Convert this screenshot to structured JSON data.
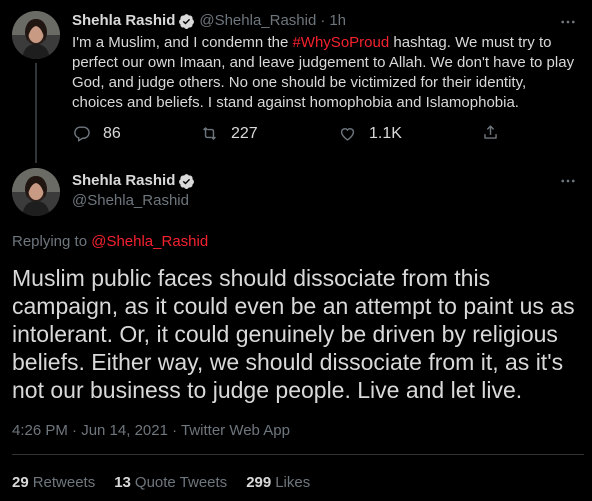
{
  "colors": {
    "background": "#000000",
    "text": "#d9d9d9",
    "secondary": "#6e767d",
    "accent_link": "#f4212e",
    "divider": "#2f3336"
  },
  "tweet1": {
    "avatar_icon": "profile-photo",
    "name": "Shehla Rashid",
    "verified_icon": "verified-badge-icon",
    "handle": "@Shehla_Rashid",
    "separator": "·",
    "time": "1h",
    "text_before": "I'm a Muslim, and I condemn the ",
    "hashtag": "#WhySoProud",
    "text_after": " hashtag. We must try to perfect our own Imaan, and leave judgement to Allah. We don't have to play God, and judge others. No one should be victimized for their identity, choices and beliefs. I stand against homophobia and Islamophobia.",
    "replies": "86",
    "retweets": "227",
    "likes": "1.1K"
  },
  "tweet2": {
    "avatar_icon": "profile-photo",
    "name": "Shehla Rashid",
    "verified_icon": "verified-badge-icon",
    "handle": "@Shehla_Rashid",
    "replying_label": "Replying to ",
    "replying_handle": "@Shehla_Rashid",
    "text": "Muslim public faces should dissociate from this campaign, as it could even be an attempt to paint us as intolerant. Or, it could genuinely be driven by religious beliefs. Either way, we should dissociate from it, as it's not our business to judge people. Live and let live.",
    "timestamp": "4:26 PM · Jun 14, 2021 · Twitter Web App",
    "stats": {
      "retweets_count": "29",
      "retweets_label": "Retweets",
      "quotes_count": "13",
      "quotes_label": "Quote Tweets",
      "likes_count": "299",
      "likes_label": "Likes"
    }
  }
}
